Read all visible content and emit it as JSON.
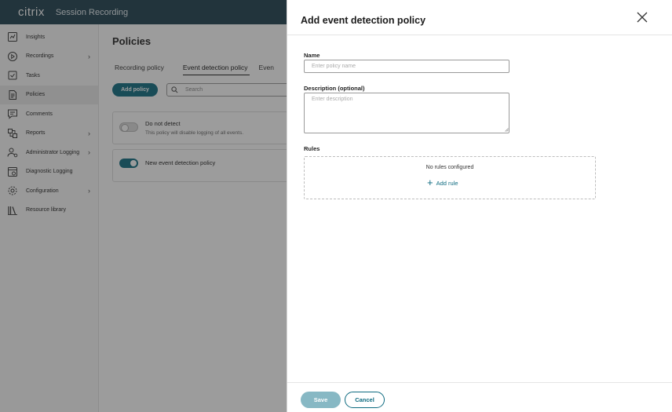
{
  "app": {
    "logo": "citrix",
    "product": "Session Recording"
  },
  "sidebar": {
    "items": [
      {
        "label": "Insights",
        "icon": "insights-icon",
        "chevron": false
      },
      {
        "label": "Recordings",
        "icon": "play-circle-icon",
        "chevron": true
      },
      {
        "label": "Tasks",
        "icon": "tasks-icon",
        "chevron": false
      },
      {
        "label": "Policies",
        "icon": "policies-icon",
        "chevron": false,
        "active": true
      },
      {
        "label": "Comments",
        "icon": "comment-icon",
        "chevron": false
      },
      {
        "label": "Reports",
        "icon": "reports-icon",
        "chevron": true
      },
      {
        "label": "Administrator Logging",
        "icon": "admin-user-icon",
        "chevron": true
      },
      {
        "label": "Diagnostic Logging",
        "icon": "diagnostic-icon",
        "chevron": false
      },
      {
        "label": "Configuration",
        "icon": "gear-icon",
        "chevron": true
      },
      {
        "label": "Resource library",
        "icon": "library-icon",
        "chevron": false
      }
    ]
  },
  "main": {
    "title": "Policies",
    "tabs": [
      {
        "label": "Recording policy",
        "active": false
      },
      {
        "label": "Event detection policy",
        "active": true
      },
      {
        "label": "Even",
        "active": false
      }
    ],
    "add_policy_label": "Add policy",
    "search_placeholder": "Search",
    "policies": [
      {
        "name": "Do not detect",
        "description": "This policy will disable logging of all events.",
        "enabled": false
      },
      {
        "name": "New event detection policy",
        "description": "",
        "enabled": true
      }
    ]
  },
  "drawer": {
    "title": "Add event detection policy",
    "name_label": "Name",
    "name_placeholder": "Enter policy name",
    "name_value": "",
    "description_label": "Description (optional)",
    "description_placeholder": "Enter description",
    "description_value": "",
    "rules_label": "Rules",
    "no_rules_text": "No rules configured",
    "add_rule_label": "Add rule",
    "save_label": "Save",
    "cancel_label": "Cancel"
  },
  "colors": {
    "topbar": "#1f3f4f",
    "accent": "#0e6b80",
    "save_disabled": "#87b8c4"
  }
}
